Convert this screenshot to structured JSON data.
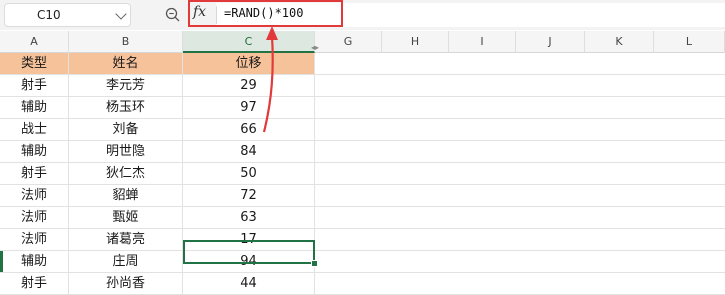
{
  "name_box": {
    "value": "C10"
  },
  "formula_bar": {
    "formula": "=RAND()*100"
  },
  "columns": [
    "A",
    "B",
    "C",
    "G",
    "H",
    "I",
    "J",
    "K",
    "L"
  ],
  "header_row": {
    "type": "类型",
    "name": "姓名",
    "move": "位移"
  },
  "rows": [
    {
      "type": "射手",
      "name": "李元芳",
      "value": "29"
    },
    {
      "type": "辅助",
      "name": "杨玉环",
      "value": "97"
    },
    {
      "type": "战士",
      "name": "刘备",
      "value": "66"
    },
    {
      "type": "辅助",
      "name": "明世隐",
      "value": "84"
    },
    {
      "type": "射手",
      "name": "狄仁杰",
      "value": "50"
    },
    {
      "type": "法师",
      "name": "貂蝉",
      "value": "72"
    },
    {
      "type": "法师",
      "name": "甄姬",
      "value": "63"
    },
    {
      "type": "法师",
      "name": "诸葛亮",
      "value": "17"
    },
    {
      "type": "辅助",
      "name": "庄周",
      "value": "94"
    },
    {
      "type": "射手",
      "name": "孙尚香",
      "value": "44"
    }
  ],
  "colors": {
    "header_fill": "#f6c29a",
    "selection": "#217346",
    "highlight": "#e23a3a"
  },
  "icons": {
    "zoom": "zoom-icon",
    "fx": "fx-icon",
    "dropdown": "chevron-down-icon"
  },
  "fx_label": "fx"
}
